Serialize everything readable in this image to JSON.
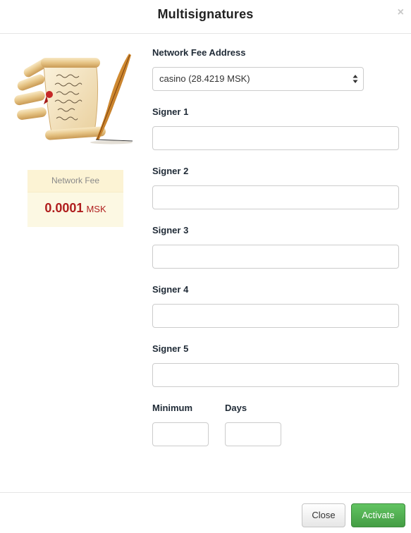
{
  "dialog": {
    "title": "Multisignatures",
    "close_glyph": "×"
  },
  "illustration": {
    "icon": "quill-scroll-icon"
  },
  "fee": {
    "label": "Network Fee",
    "amount": "0.0001",
    "unit": "MSK"
  },
  "form": {
    "network_fee_address": {
      "label": "Network Fee Address",
      "selected": "casino (28.4219 MSK)"
    },
    "signers": [
      {
        "label": "Signer 1",
        "value": ""
      },
      {
        "label": "Signer 2",
        "value": ""
      },
      {
        "label": "Signer 3",
        "value": ""
      },
      {
        "label": "Signer 4",
        "value": ""
      },
      {
        "label": "Signer 5",
        "value": ""
      }
    ],
    "minimum": {
      "label": "Minimum",
      "value": ""
    },
    "days": {
      "label": "Days",
      "value": ""
    }
  },
  "footer": {
    "close_label": "Close",
    "activate_label": "Activate"
  },
  "colors": {
    "accent_green": "#5cb85c",
    "fee_red": "#b01e1e",
    "fee_box_bg": "#fcf8e3"
  }
}
